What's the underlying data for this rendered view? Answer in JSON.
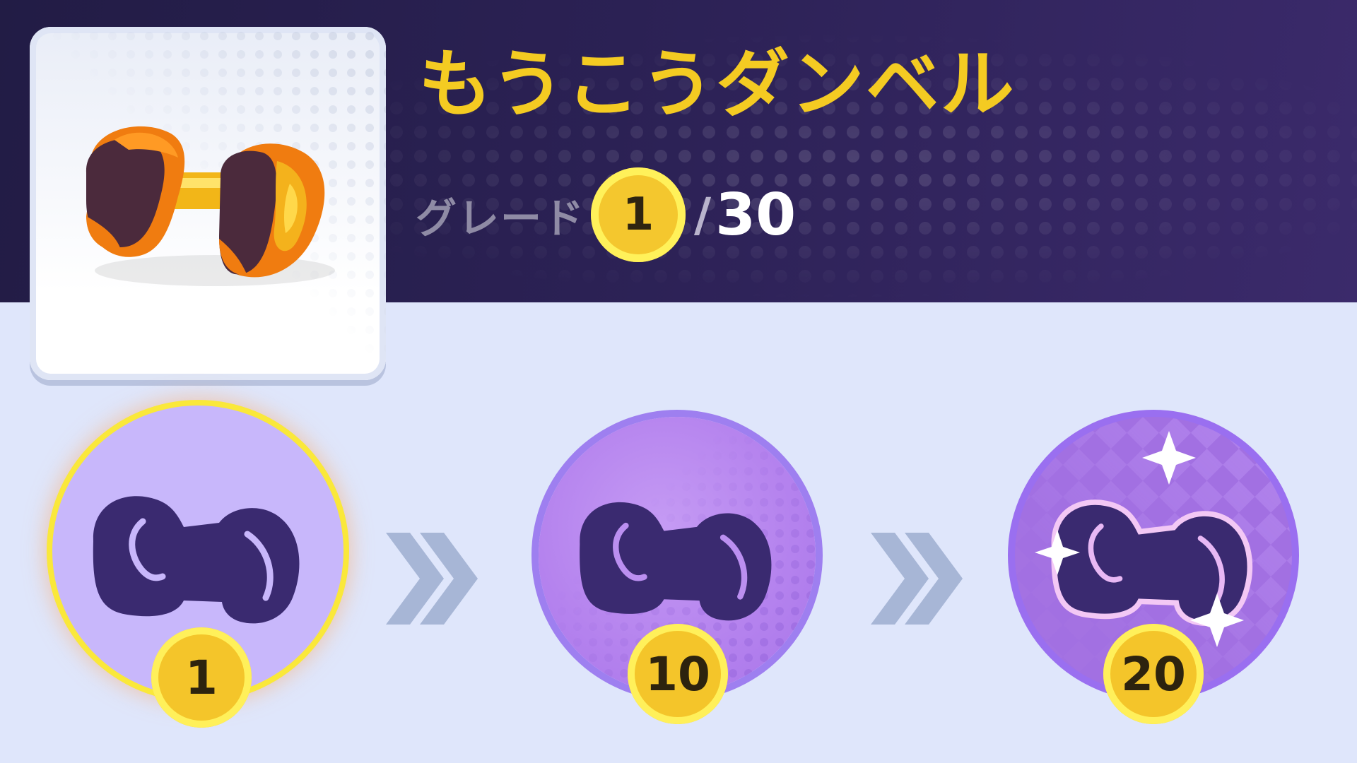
{
  "item": {
    "name": "もうこうダンベル",
    "icon": "dumbbell-icon"
  },
  "grade": {
    "label": "グレード",
    "current": "1",
    "separator": "/",
    "max": "30"
  },
  "stages": [
    {
      "level": "1",
      "icon": "dumbbell-silhouette-icon",
      "state": "active"
    },
    {
      "level": "10",
      "icon": "dumbbell-silhouette-icon",
      "state": "locked"
    },
    {
      "level": "20",
      "icon": "dumbbell-silhouette-sparkle-icon",
      "state": "locked"
    }
  ],
  "connector_icon": "double-chevron-right-icon",
  "colors": {
    "title": "#f4cb22",
    "header_bg": "#2b2154",
    "page_bg": "#dfe6fb",
    "coin": "#f4c72e",
    "coin_ring": "#fff15a"
  }
}
